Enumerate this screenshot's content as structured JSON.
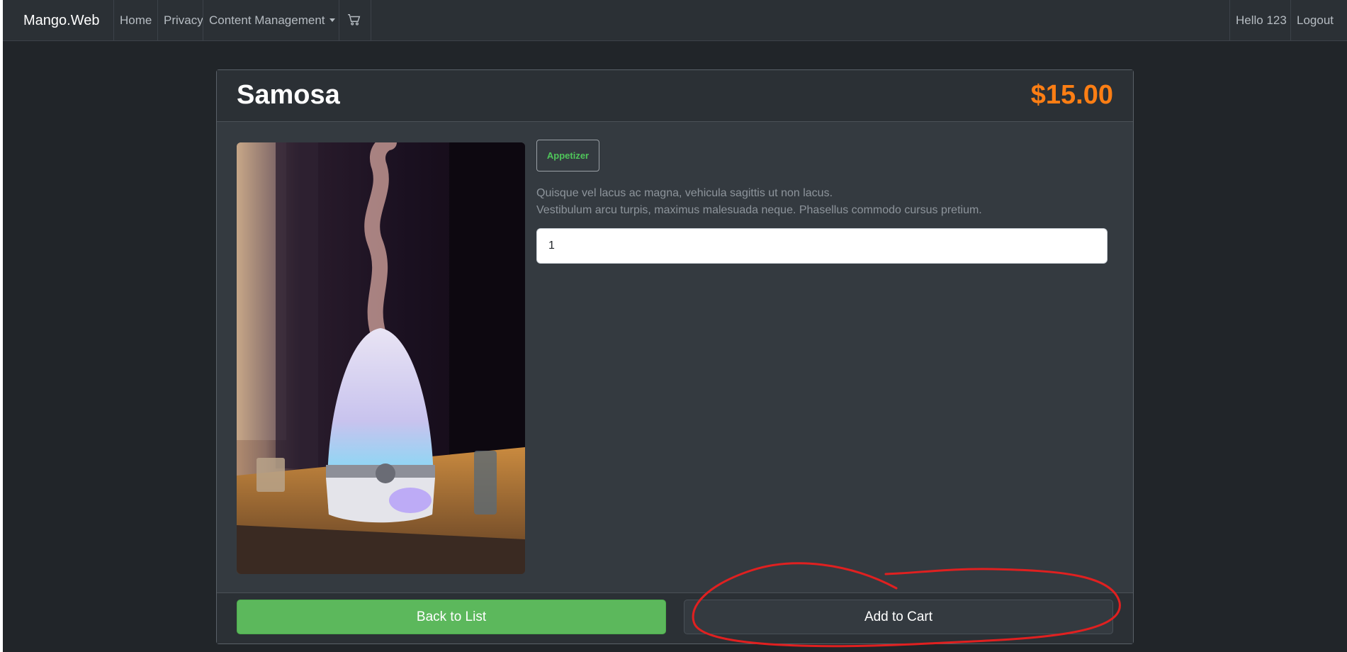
{
  "navbar": {
    "brand": "Mango.Web",
    "links": [
      "Home",
      "Privacy",
      "Content Management"
    ],
    "cart_icon": "cart-icon",
    "greeting": "Hello 123",
    "logout": "Logout"
  },
  "product": {
    "name": "Samosa",
    "price": "$15.00",
    "category": "Appetizer",
    "description_line1": "Quisque vel lacus ac magna, vehicula sagittis ut non lacus.",
    "description_line2": "Vestibulum arcu turpis, maximus malesuada neque. Phasellus commodo cursus pretium.",
    "quantity": "1"
  },
  "actions": {
    "back_label": "Back to List",
    "cart_label": "Add to Cart"
  },
  "colors": {
    "background": "#212529",
    "navbar": "#2b3035",
    "card": "#343a40",
    "price": "#fd7e14",
    "badge_text": "#4fc55a",
    "back_button": "#5cb85c",
    "annotation": "#e02020"
  }
}
